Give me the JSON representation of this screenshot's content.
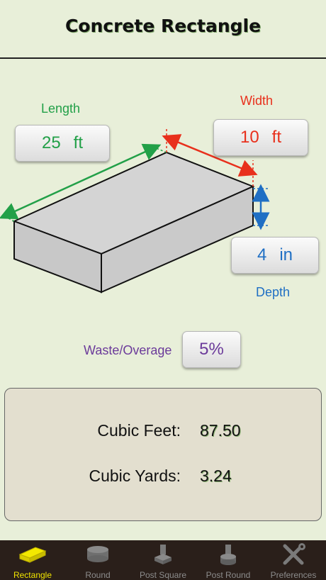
{
  "header": {
    "title": "Concrete Rectangle"
  },
  "inputs": {
    "length": {
      "label": "Length",
      "value": "25",
      "unit": "ft"
    },
    "width": {
      "label": "Width",
      "value": "10",
      "unit": "ft"
    },
    "depth": {
      "label": "Depth",
      "value": "4",
      "unit": "in"
    },
    "waste": {
      "label": "Waste/Overage",
      "value": "5%"
    }
  },
  "results": {
    "cubic_feet": {
      "label": "Cubic Feet:",
      "value": "87.50"
    },
    "cubic_yards": {
      "label": "Cubic Yards:",
      "value": "3.24"
    }
  },
  "tabs": [
    {
      "label": "Rectangle",
      "icon": "rectangle-slab-icon",
      "active": true
    },
    {
      "label": "Round",
      "icon": "round-slab-icon",
      "active": false
    },
    {
      "label": "Post Square",
      "icon": "post-square-icon",
      "active": false
    },
    {
      "label": "Post Round",
      "icon": "post-round-icon",
      "active": false
    },
    {
      "label": "Preferences",
      "icon": "tools-icon",
      "active": false
    }
  ],
  "colors": {
    "background": "#e8efd9",
    "length": "#22a048",
    "width": "#e8301c",
    "depth": "#1f6fc4",
    "waste": "#6b3a9a",
    "tab_active": "#f0e400",
    "tabbar": "#2a1f1a"
  }
}
